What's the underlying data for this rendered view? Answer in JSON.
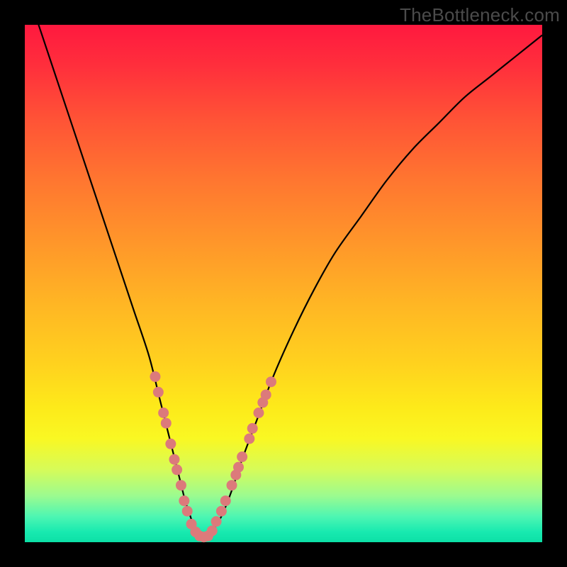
{
  "watermark": "TheBottleneck.com",
  "colors": {
    "background": "#000000",
    "curve_stroke": "#000000",
    "marker_fill": "#dc7a7b",
    "gradient_top": "#ff193f",
    "gradient_bottom": "#0ce0a6"
  },
  "chart_data": {
    "type": "line",
    "title": "",
    "xlabel": "",
    "ylabel": "",
    "xlim": [
      0,
      100
    ],
    "ylim": [
      0,
      100
    ],
    "grid": false,
    "legend": false,
    "series": [
      {
        "name": "bottleneck-curve",
        "x": [
          0,
          3,
          6,
          9,
          12,
          15,
          18,
          21,
          24,
          26,
          28,
          30,
          31,
          32,
          33,
          34,
          35,
          36,
          38,
          40,
          42,
          45,
          48,
          52,
          56,
          60,
          65,
          70,
          75,
          80,
          85,
          90,
          95,
          100
        ],
        "values": [
          108,
          99,
          90,
          81,
          72,
          63,
          54,
          45,
          36,
          28,
          20,
          12,
          8,
          5,
          2,
          1,
          1,
          2,
          5,
          10,
          16,
          24,
          32,
          41,
          49,
          56,
          63,
          70,
          76,
          81,
          86,
          90,
          94,
          98
        ]
      }
    ],
    "markers": {
      "name": "highlight-points",
      "points": [
        {
          "x": 25.2,
          "y": 32
        },
        {
          "x": 25.8,
          "y": 29
        },
        {
          "x": 26.8,
          "y": 25
        },
        {
          "x": 27.3,
          "y": 23
        },
        {
          "x": 28.2,
          "y": 19
        },
        {
          "x": 28.9,
          "y": 16
        },
        {
          "x": 29.4,
          "y": 14
        },
        {
          "x": 30.2,
          "y": 11
        },
        {
          "x": 30.8,
          "y": 8
        },
        {
          "x": 31.4,
          "y": 6
        },
        {
          "x": 32.2,
          "y": 3.5
        },
        {
          "x": 33.0,
          "y": 2
        },
        {
          "x": 33.8,
          "y": 1.2
        },
        {
          "x": 34.6,
          "y": 1
        },
        {
          "x": 35.4,
          "y": 1.2
        },
        {
          "x": 36.2,
          "y": 2.2
        },
        {
          "x": 37.0,
          "y": 4
        },
        {
          "x": 38.0,
          "y": 6
        },
        {
          "x": 38.8,
          "y": 8
        },
        {
          "x": 40.0,
          "y": 11
        },
        {
          "x": 40.8,
          "y": 13
        },
        {
          "x": 41.3,
          "y": 14.5
        },
        {
          "x": 42.0,
          "y": 16.5
        },
        {
          "x": 43.4,
          "y": 20
        },
        {
          "x": 44.0,
          "y": 22
        },
        {
          "x": 45.2,
          "y": 25
        },
        {
          "x": 46.0,
          "y": 27
        },
        {
          "x": 46.6,
          "y": 28.5
        },
        {
          "x": 47.6,
          "y": 31
        }
      ]
    }
  }
}
